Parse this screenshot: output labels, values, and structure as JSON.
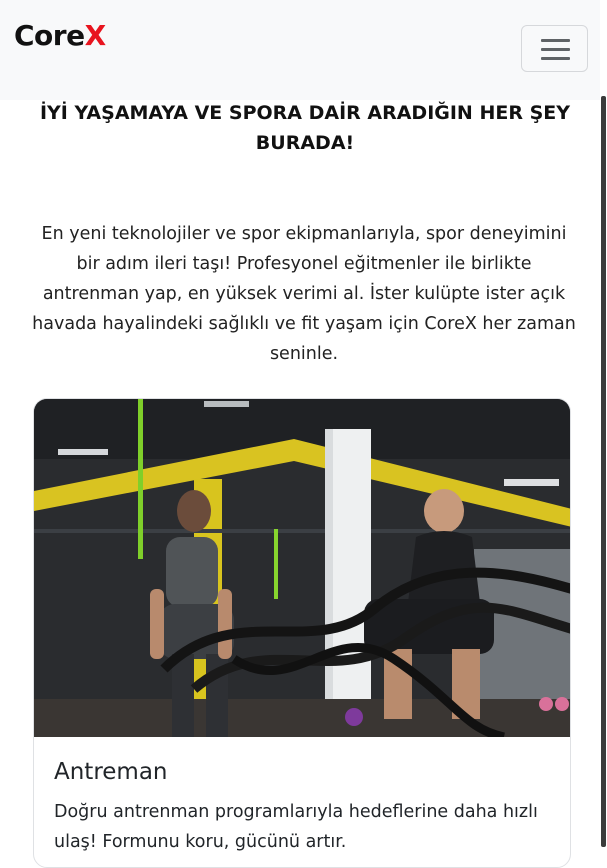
{
  "navbar": {
    "brand_main": "Core",
    "brand_accent": "X",
    "toggler_icon": "hamburger-menu-icon",
    "accent_color": "#e8141e"
  },
  "hero": {
    "headline": "İYİ YAŞAMAYA VE SPORA DAİR ARADIĞIN HER ŞEY BURADA!",
    "intro": "En yeni teknolojiler ve spor ekipmanlarıyla, spor deneyimini bir adım ileri taşı! Profesyonel eğitmenler ile birlikte antrenman yap, en yüksek verimi al. İster kulüpte ister açık havada hayalindeki sağlıklı ve fit yaşam için CoreX her zaman seninle."
  },
  "cards": [
    {
      "title": "Antreman",
      "text": "Doğru antrenman programlarıyla hedeflerine daha hızlı ulaş! Formunu koru, gücünü artır."
    }
  ]
}
